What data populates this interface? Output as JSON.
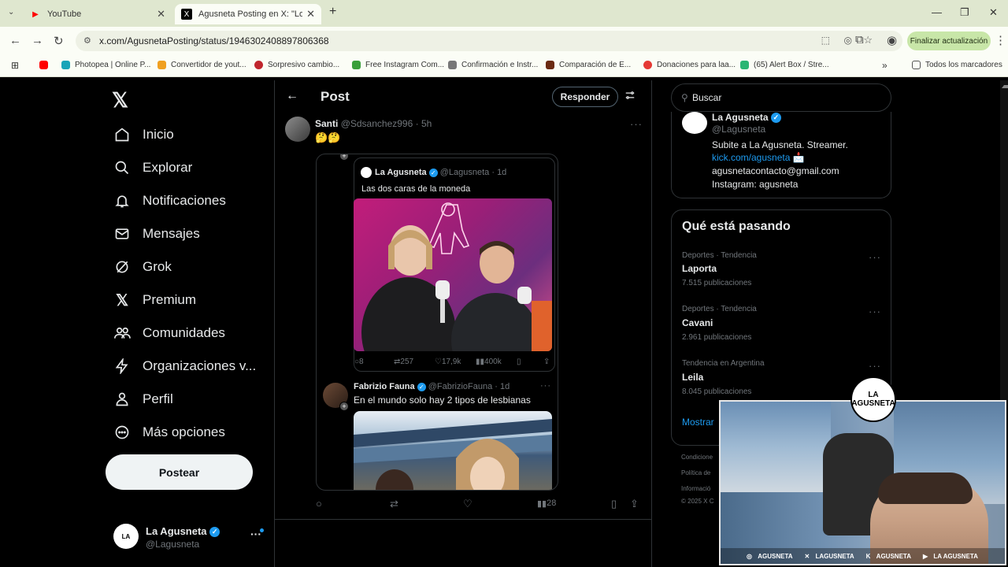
{
  "browser": {
    "tabs": [
      {
        "title": "YouTube",
        "active": false,
        "icon": "youtube-icon"
      },
      {
        "title": "Agusneta Posting en X: \"Los do",
        "active": true,
        "icon": "x-icon"
      }
    ],
    "url": "x.com/AgusnetaPosting/status/1946302408897806368",
    "update_button": "Finalizar actualización",
    "bookmarks": [
      "Photopea | Online P...",
      "Convertidor de yout...",
      "Sorpresivo cambio...",
      "Free Instagram Com...",
      "Confirmación e Instr...",
      "Comparación de E...",
      "Donaciones para laa...",
      "(65) Alert Box / Stre..."
    ],
    "all_bookmarks": "Todos los marcadores"
  },
  "sidebar": {
    "items": [
      {
        "label": "Inicio",
        "icon": "home-icon"
      },
      {
        "label": "Explorar",
        "icon": "search-icon"
      },
      {
        "label": "Notificaciones",
        "icon": "bell-icon"
      },
      {
        "label": "Mensajes",
        "icon": "mail-icon"
      },
      {
        "label": "Grok",
        "icon": "grok-icon"
      },
      {
        "label": "Premium",
        "icon": "x-icon"
      },
      {
        "label": "Comunidades",
        "icon": "people-icon"
      },
      {
        "label": "Organizaciones v...",
        "icon": "lightning-icon"
      },
      {
        "label": "Perfil",
        "icon": "person-icon"
      },
      {
        "label": "Más opciones",
        "icon": "more-circle-icon"
      }
    ],
    "post_button": "Postear",
    "account": {
      "name": "La Agusneta",
      "handle": "@Lagusneta"
    }
  },
  "header": {
    "title": "Post",
    "reply_button": "Responder"
  },
  "tweet": {
    "author": "Santi",
    "handle": "@Sdsanchez996",
    "time": "· 5h",
    "text": "🤔🤔",
    "quote1": {
      "author": "La Agusneta",
      "handle": "@Lagusneta",
      "time": "· 1d",
      "text": "Las dos caras de la moneda",
      "stats": {
        "replies": "8",
        "reposts": "257",
        "likes": "17,9k",
        "views": "400k"
      }
    },
    "quote2": {
      "author": "Fabrizio Fauna",
      "handle": "@FabrizioFauna",
      "time": "· 1d",
      "text": "En el mundo solo hay 2 tipos de lesbianas"
    },
    "views": "28"
  },
  "right": {
    "search_placeholder": "Buscar",
    "profile": {
      "name": "La Agusneta",
      "handle": "@Lagusneta",
      "bio1": "Subite a La Agusneta. Streamer.",
      "link": "kick.com/agusneta 📩",
      "email": "agusnetacontacto@gmail.com",
      "instagram": "Instagram: agusneta"
    },
    "trends_title": "Qué está pasando",
    "trends": [
      {
        "meta": "Deportes · Tendencia",
        "name": "Laporta",
        "count": "7.515 publicaciones"
      },
      {
        "meta": "Deportes · Tendencia",
        "name": "Cavani",
        "count": "2.961 publicaciones"
      },
      {
        "meta": "Tendencia en Argentina",
        "name": "Leila",
        "count": "8.045 publicaciones"
      }
    ],
    "show_more": "Mostrar",
    "footer": [
      "Condicione",
      "Política de",
      "Informació",
      "© 2025 X C"
    ]
  },
  "webcam": {
    "logo": "LA AGUSNETA",
    "socials": [
      "AGUSNETA",
      "LAGUSNETA",
      "AGUSNETA",
      "LA AGUSNETA"
    ]
  },
  "colors": {
    "accent": "#1d9bf0",
    "background": "#000000",
    "border": "#2f3336"
  }
}
